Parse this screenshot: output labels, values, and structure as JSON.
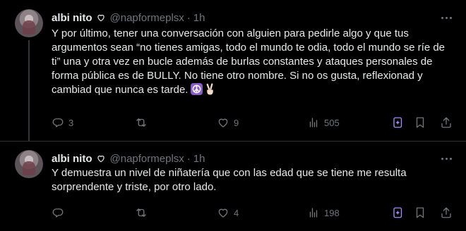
{
  "tweets": [
    {
      "author_name": "albi nito",
      "handle": "@napformeplsx",
      "separator": "·",
      "time": "1h",
      "text": "Y por último, tener una conversación con alguien para pedirle algo y que tus argumentos sean “no tienes amigas, todo el mundo te odia, todo el mundo se ríe de ti” una y otra vez en bucle además de burlas constantes y ataques personales de forma pública es de BULLY. No tiene otro nombre. Si no os gusta, reflexionad y cambiad que nunca es tarde.",
      "emojis": [
        "peace-symbol-icon",
        "victory-hand-icon"
      ],
      "replies": "3",
      "reposts": "",
      "likes": "9",
      "views": "505"
    },
    {
      "author_name": "albi nito",
      "handle": "@napformeplsx",
      "separator": "·",
      "time": "1h",
      "text": "Y demuestra un nivel de niñatería que con las edad que se tiene me resulta sorprendente y triste, por otro lado.",
      "replies": "",
      "reposts": "",
      "likes": "4",
      "views": "198"
    }
  ],
  "colors": {
    "background": "#000000",
    "text": "#e7e9ea",
    "muted": "#71767b",
    "grok_accent": "#a58bf9",
    "divider": "#2f3336"
  }
}
